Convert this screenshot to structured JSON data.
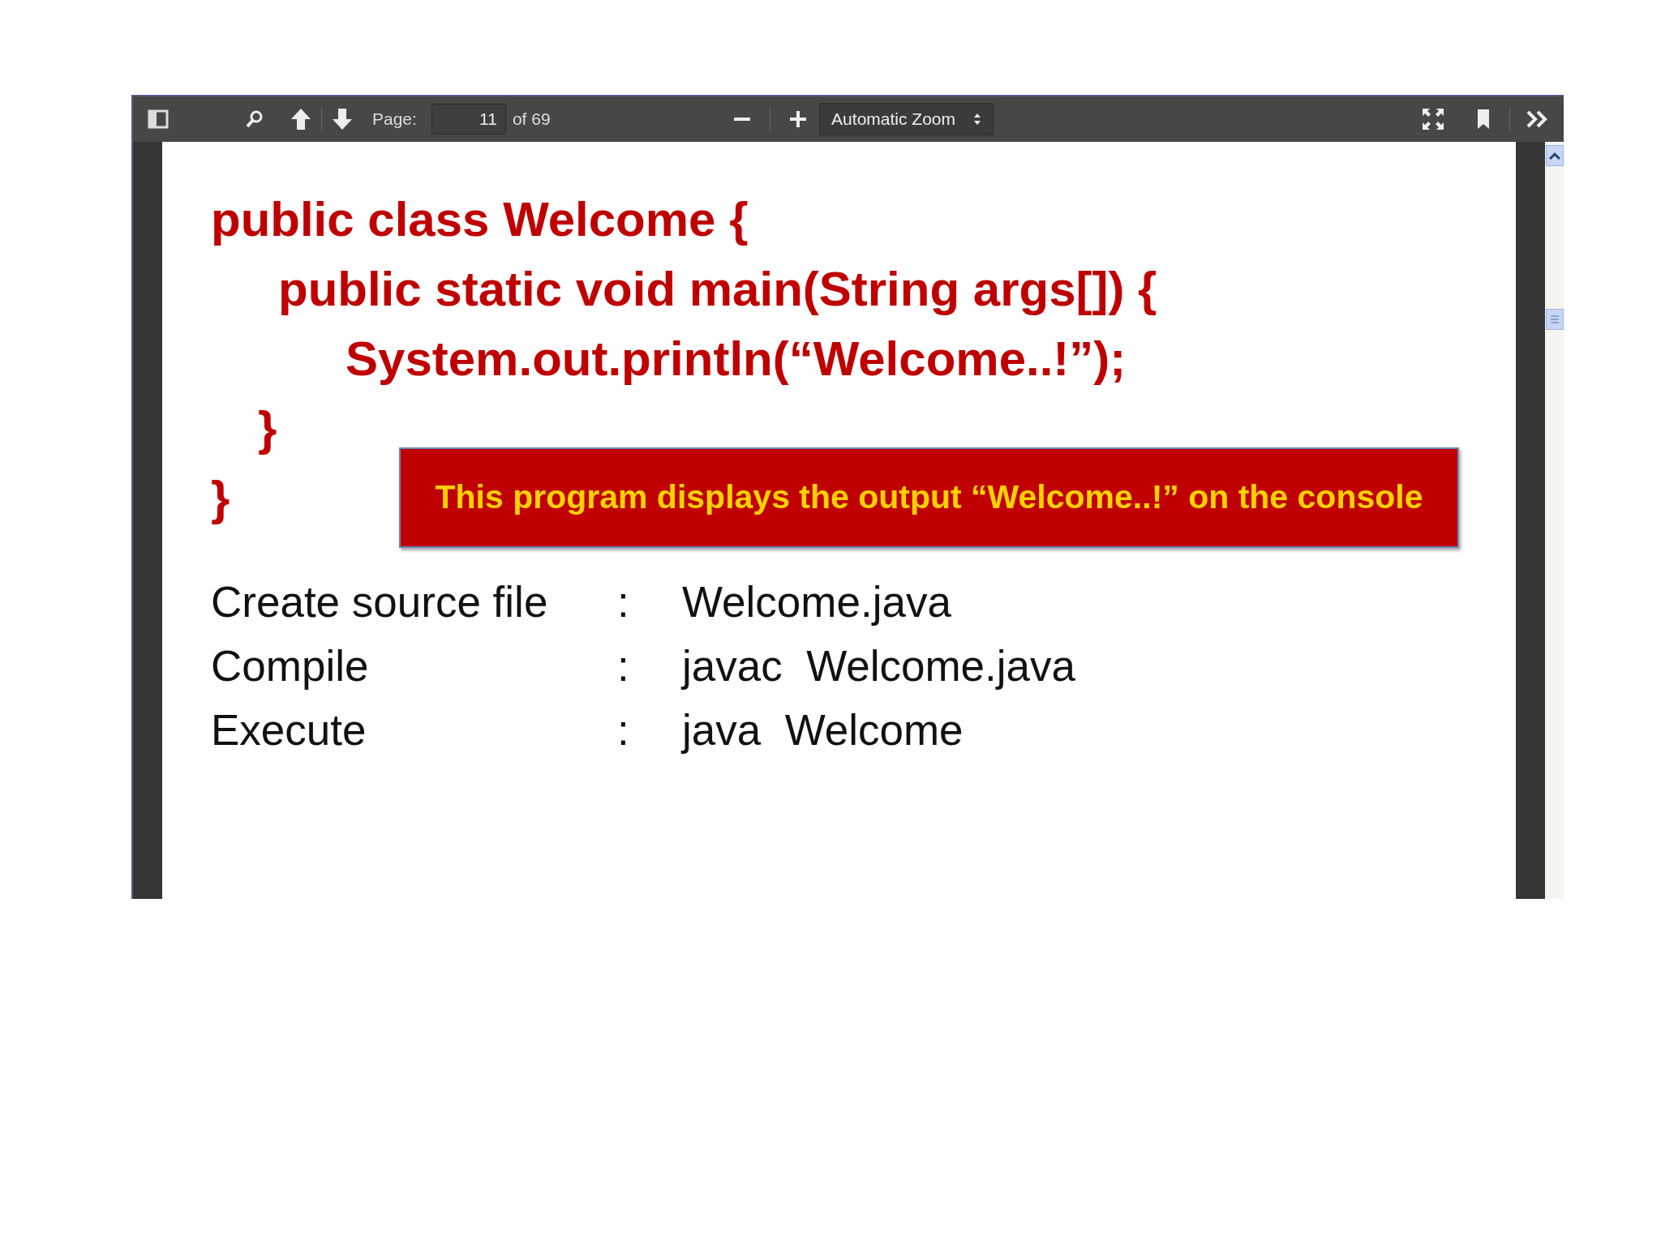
{
  "toolbar": {
    "page_label": "Page:",
    "page_value": "11",
    "page_count": "of 69",
    "zoom_select": "Automatic Zoom"
  },
  "slide": {
    "code": {
      "open": "public class Welcome {",
      "children": [
        {
          "open": "public static void main(String args[]) {",
          "children": [
            {
              "open": "System.out.println(“Welcome..!”);"
            }
          ],
          "close": "}"
        }
      ],
      "close": "}"
    },
    "callout": "This program displays the output “Welcome..!” on the console",
    "steps": [
      {
        "label": "Create source file",
        "separator": ":",
        "command": "Welcome.java"
      },
      {
        "label": "Compile",
        "separator": ":",
        "command": "javac  Welcome.java"
      },
      {
        "label": "Execute",
        "separator": ":",
        "command": "java  Welcome"
      }
    ]
  }
}
